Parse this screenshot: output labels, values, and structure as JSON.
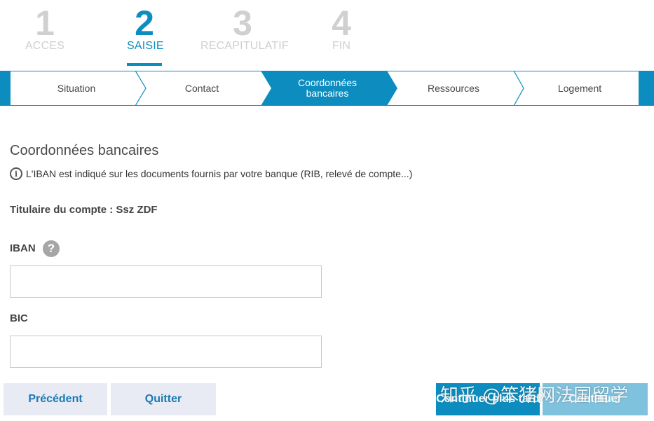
{
  "steps": [
    {
      "number": "1",
      "label": "ACCES"
    },
    {
      "number": "2",
      "label": "SAISIE"
    },
    {
      "number": "3",
      "label": "RECAPITULATIF"
    },
    {
      "number": "4",
      "label": "FIN"
    }
  ],
  "substeps": [
    {
      "label": "Situation"
    },
    {
      "label": "Contact"
    },
    {
      "label": "Coordonnées bancaires"
    },
    {
      "label": "Ressources"
    },
    {
      "label": "Logement"
    }
  ],
  "section": {
    "title": "Coordonnées bancaires",
    "info": "L'IBAN est indiqué sur les documents fournis par votre banque (RIB, relevé de compte...)",
    "holder": "Titulaire du compte : Ssz ZDF"
  },
  "form": {
    "iban_label": "IBAN",
    "iban_value": "",
    "bic_label": "BIC",
    "bic_value": ""
  },
  "buttons": {
    "previous": "Précédent",
    "quit": "Quitter",
    "later": "Continuer plus tard",
    "continue": "Continuer"
  },
  "watermark": "知乎 @笨猪网法国留学",
  "colors": {
    "accent": "#0d8dbf",
    "inactive_step": "#cfcfcf",
    "light_button": "#e8ebf3",
    "disabled_button": "#7fc2de"
  }
}
